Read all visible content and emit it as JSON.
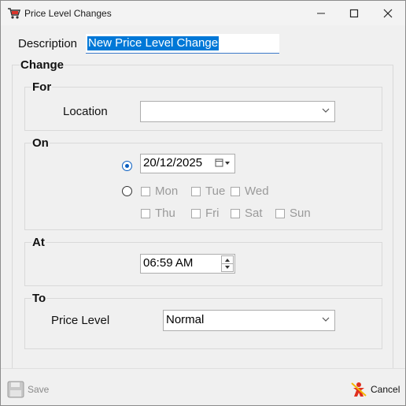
{
  "window": {
    "title": "Price Level Changes",
    "icon": "cart-icon"
  },
  "description": {
    "label": "Description",
    "value": "New Price Level Change"
  },
  "change_group": {
    "label": "Change",
    "for": {
      "label": "For",
      "location_label": "Location",
      "location_value": ""
    },
    "on": {
      "label": "On",
      "date_value": "20/12/2025",
      "date_radio_checked": true,
      "days_radio_checked": false,
      "days": [
        "Mon",
        "Tue",
        "Wed",
        "Thu",
        "Fri",
        "Sat",
        "Sun"
      ]
    },
    "at": {
      "label": "At",
      "time_value": "06:59 AM"
    },
    "to": {
      "label": "To",
      "price_level_label": "Price Level",
      "price_level_value": "Normal"
    }
  },
  "footer": {
    "save_label": "Save",
    "cancel_label": "Cancel"
  },
  "colors": {
    "accent": "#0078d7",
    "radio": "#0b5fc1",
    "disabled_text": "#9a9a9a"
  }
}
